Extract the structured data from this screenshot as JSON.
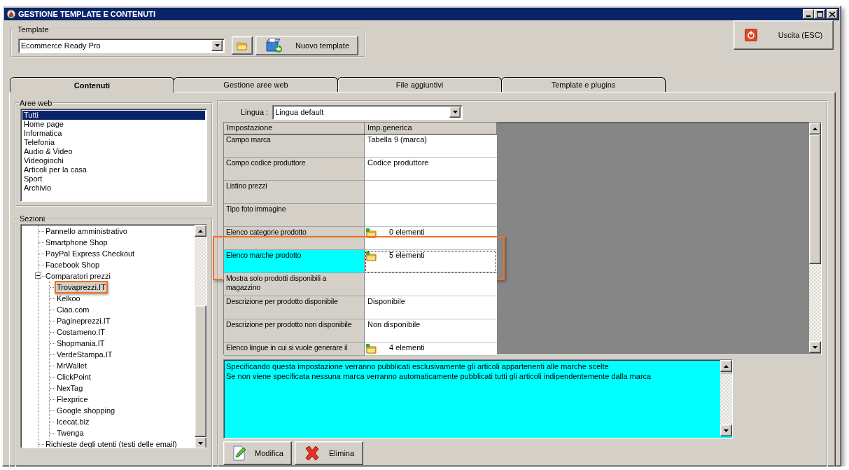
{
  "window": {
    "title": "GESTIONE TEMPLATE E CONTENUTI"
  },
  "template": {
    "label": "Template",
    "value": "Ecommerce Ready Pro",
    "new_button": "Nuovo template"
  },
  "exit_button": "Uscita (ESC)",
  "tabs": [
    {
      "label": "Contenuti",
      "selected": true
    },
    {
      "label": "Gestione aree web",
      "selected": false
    },
    {
      "label": "File aggiuntivi",
      "selected": false
    },
    {
      "label": "Template e plugins",
      "selected": false
    }
  ],
  "aree_web": {
    "label": "Aree web",
    "items": [
      {
        "label": "Tutti",
        "selected": true
      },
      {
        "label": "Home page",
        "selected": false
      },
      {
        "label": "Informatica",
        "selected": false
      },
      {
        "label": "Telefonia",
        "selected": false
      },
      {
        "label": "Audio & Video",
        "selected": false
      },
      {
        "label": "Videogiochi",
        "selected": false
      },
      {
        "label": "Articoli per la casa",
        "selected": false
      },
      {
        "label": "Sport",
        "selected": false
      },
      {
        "label": "Archivio",
        "selected": false
      }
    ]
  },
  "sezioni": {
    "label": "Sezioni",
    "items": [
      {
        "label": "Pannello amministrativo",
        "selected": false,
        "highlighted": false
      },
      {
        "label": "Smartphone Shop",
        "selected": false,
        "highlighted": false
      },
      {
        "label": "PayPal Express Checkout",
        "selected": false,
        "highlighted": false
      },
      {
        "label": "Facebook Shop",
        "selected": false,
        "highlighted": false
      },
      {
        "label": "Comparatori prezzi",
        "selected": false,
        "highlighted": false,
        "expanded": true,
        "children": [
          {
            "label": "Trovaprezzi.IT",
            "selected": true,
            "highlighted": true
          },
          {
            "label": "Kelkoo",
            "selected": false,
            "highlighted": false
          },
          {
            "label": "Ciao.com",
            "selected": false,
            "highlighted": false
          },
          {
            "label": "Pagineprezzi.IT",
            "selected": false,
            "highlighted": false
          },
          {
            "label": "Costameno.IT",
            "selected": false,
            "highlighted": false
          },
          {
            "label": "Shopmania.IT",
            "selected": false,
            "highlighted": false
          },
          {
            "label": "VerdeStampa.IT",
            "selected": false,
            "highlighted": false
          },
          {
            "label": "MrWallet",
            "selected": false,
            "highlighted": false
          },
          {
            "label": "ClickPoint",
            "selected": false,
            "highlighted": false
          },
          {
            "label": "NexTag",
            "selected": false,
            "highlighted": false
          },
          {
            "label": "Flexprice",
            "selected": false,
            "highlighted": false
          },
          {
            "label": "Google shopping",
            "selected": false,
            "highlighted": false
          },
          {
            "label": "Icecat.biz",
            "selected": false,
            "highlighted": false
          },
          {
            "label": "Twenga",
            "selected": false,
            "highlighted": false
          }
        ]
      },
      {
        "label": "Richieste degli utenti (testi delle email)",
        "selected": false,
        "highlighted": false
      }
    ]
  },
  "lingua": {
    "label": "Lingua :",
    "value": "Lingua default"
  },
  "grid": {
    "columns": [
      "Impostazione",
      "Imp.generica"
    ],
    "rows": [
      {
        "setting": "Campo marca",
        "kind": "text",
        "value": "Tabella 9 (marca)",
        "selected": false,
        "highlighted": false
      },
      {
        "setting": "Campo codice produttore",
        "kind": "text",
        "value": "Codice produttore",
        "selected": false,
        "highlighted": false
      },
      {
        "setting": "Listino prezzi",
        "kind": "text",
        "selected": false,
        "highlighted": false
      },
      {
        "setting": "Tipo foto immagine",
        "kind": "text",
        "selected": false,
        "highlighted": false
      },
      {
        "setting": "Elenco categorie prodotto",
        "kind": "list",
        "value": "0 elementi",
        "selected": false,
        "highlighted": false
      },
      {
        "setting": "Elenco marche prodotto",
        "kind": "list",
        "value": "5 elementi",
        "selected": true,
        "highlighted": true
      },
      {
        "setting": "Mostra solo prodotti disponibili a magazzino",
        "kind": "text",
        "selected": false,
        "highlighted": false
      },
      {
        "setting": "Descrizione per prodotto disponibile",
        "kind": "text",
        "value": "Disponibile",
        "selected": false,
        "highlighted": false
      },
      {
        "setting": "Descrizione per prodotto non disponibile",
        "kind": "text",
        "value": "Non disponibile",
        "selected": false,
        "highlighted": false
      },
      {
        "setting": "Elenco lingue in cui si vuole generare il",
        "kind": "list",
        "value": "4 elementi",
        "selected": false,
        "highlighted": false
      }
    ]
  },
  "description": {
    "lines": [
      "Specificando questa impostazione verranno pubblicati esclusivamente gli articoli appartenenti alle marche scelte",
      "Se non viene specificata nessuna marca verranno automaticamente pubblicati tutti gli articoli indipendentemente dalla marca"
    ]
  },
  "buttons": [
    {
      "label": "Modifica",
      "kind": "edit"
    },
    {
      "label": "Elimina",
      "kind": "delete"
    }
  ]
}
